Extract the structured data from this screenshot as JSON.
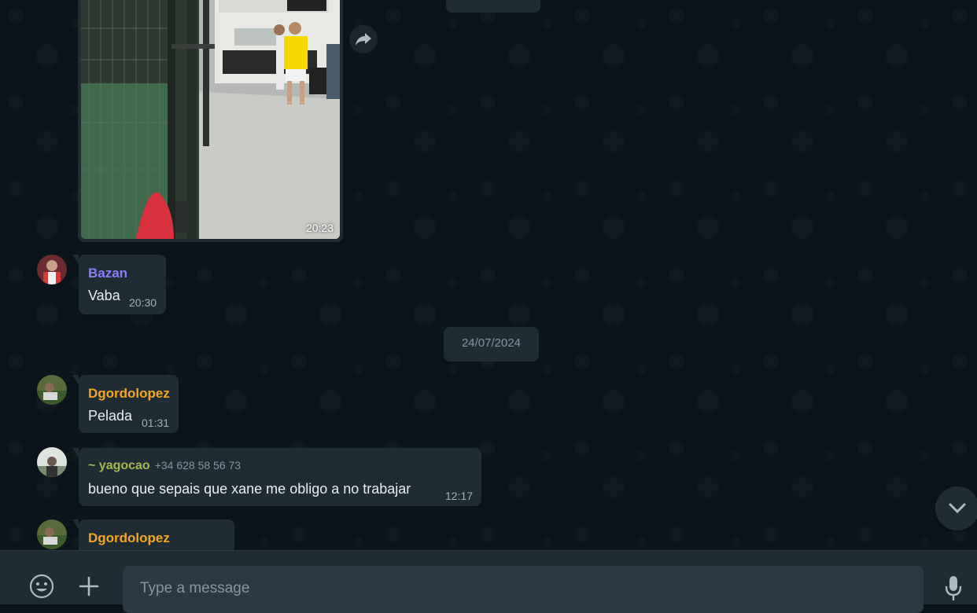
{
  "colors": {
    "background": "#0b141a",
    "bubble": "#202c33",
    "footer": "#202c33",
    "input": "#2a3942",
    "sender_bazan": "#8c7cff",
    "sender_dgordolopez": "#f5a623",
    "sender_yagocao": "#a5b84d",
    "time": "#a5b0b7"
  },
  "top_date_pill": {
    "label": ""
  },
  "image_message": {
    "time": "20:23",
    "forward_icon": "forward-icon"
  },
  "messages": [
    {
      "sender": "Bazan",
      "text": "Vaba",
      "time": "20:30"
    },
    {
      "sender": "Dgordolopez",
      "text": "Pelada",
      "time": "01:31"
    },
    {
      "sender": "~ yagocao",
      "phone": "+34 628 58 56 73",
      "text": "bueno que sepais que xane me obligo a no trabajar",
      "time": "12:17"
    },
    {
      "sender": "Dgordolopez",
      "text": "",
      "time": ""
    }
  ],
  "date_separator": {
    "label": "24/07/2024"
  },
  "footer": {
    "emoji_icon": "emoji-icon",
    "attach_icon": "plus-icon",
    "placeholder": "Type a message",
    "mic_icon": "microphone-icon"
  },
  "scroll_down_icon": "chevron-down-icon"
}
